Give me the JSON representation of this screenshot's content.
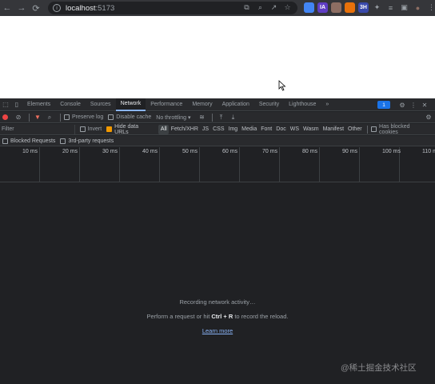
{
  "browser": {
    "url_host": "localhost",
    "url_port": ":5173",
    "extensions": [
      {
        "name": "ext-blue",
        "text": "",
        "color": "#4285f4"
      },
      {
        "name": "ext-ia",
        "text": "IA",
        "color": "#5f3dc4"
      },
      {
        "name": "ext-face",
        "text": "",
        "color": "#8d6e63"
      },
      {
        "name": "ext-orange",
        "text": "",
        "color": "#e8710a"
      },
      {
        "name": "ext-3h",
        "text": "3H",
        "color": "#3949ab"
      }
    ]
  },
  "devtools": {
    "tabs": [
      "Elements",
      "Console",
      "Sources",
      "Network",
      "Performance",
      "Memory",
      "Application",
      "Security",
      "Lighthouse"
    ],
    "active_tab": "Network",
    "more_tabs": "»",
    "issues_count": "1",
    "toolbar": {
      "preserve_log": "Preserve log",
      "disable_cache": "Disable cache",
      "throttling": "No throttling"
    },
    "filter": {
      "placeholder": "Filter",
      "invert": "Invert",
      "hide_data_urls": "Hide data URLs",
      "types": [
        "All",
        "Fetch/XHR",
        "JS",
        "CSS",
        "Img",
        "Media",
        "Font",
        "Doc",
        "WS",
        "Wasm",
        "Manifest",
        "Other"
      ],
      "active_type": "All",
      "has_blocked_cookies": "Has blocked cookies"
    },
    "block": {
      "blocked_requests": "Blocked Requests",
      "third_party": "3rd-party requests"
    },
    "timeline_ticks": [
      "10 ms",
      "20 ms",
      "30 ms",
      "40 ms",
      "50 ms",
      "60 ms",
      "70 ms",
      "80 ms",
      "90 ms",
      "100 ms",
      "110 ms"
    ],
    "empty": {
      "recording": "Recording network activity…",
      "hint_prefix": "Perform a request or hit ",
      "hint_keys": "Ctrl + R",
      "hint_suffix": " to record the reload.",
      "learn_more": "Learn more"
    }
  },
  "watermark": "@稀土掘金技术社区",
  "colors": {
    "accent": "#8ab4f8",
    "record": "#ee4444",
    "checkbox_on": "#f29900"
  }
}
